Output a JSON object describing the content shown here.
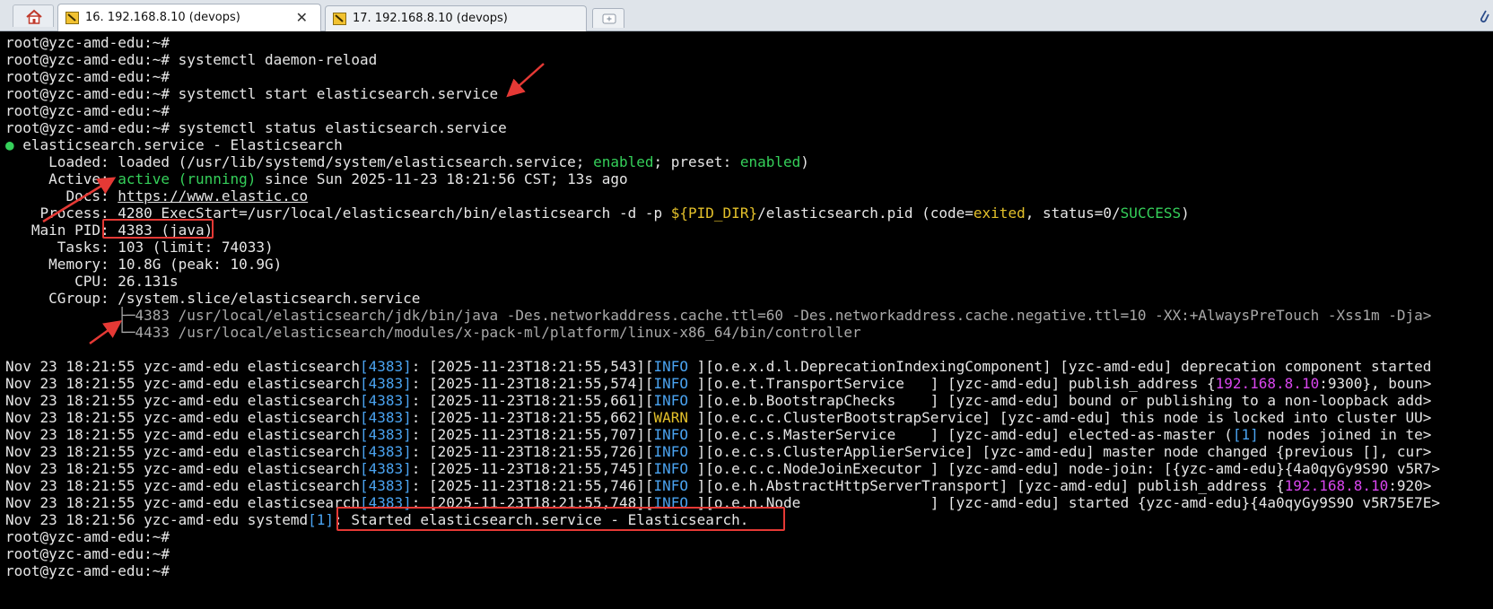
{
  "tabs": [
    {
      "label": "16. 192.168.8.10 (devops)",
      "close": "✕"
    },
    {
      "label": "17. 192.168.8.10 (devops)"
    }
  ],
  "terminal": {
    "prompt": "root@yzc-amd-edu:~#",
    "cmds": {
      "daemon_reload": "systemctl daemon-reload",
      "start": "systemctl start elasticsearch.service",
      "status": "systemctl status elasticsearch.service"
    },
    "status": {
      "bullet": "●",
      "unit_title": "elasticsearch.service - Elasticsearch",
      "loaded_label": "Loaded:",
      "loaded_pre": "loaded (/usr/lib/systemd/system/elasticsearch.service;",
      "loaded_enabled": "enabled",
      "loaded_mid": "; preset:",
      "loaded_preset": "enabled",
      "loaded_end": ")",
      "active_label": "Active:",
      "active_state": "active (running)",
      "active_since": "since Sun 2025-11-23 18:21:56 CST; 13s ago",
      "docs_label": "Docs:",
      "docs_url": "https://www.elastic.co",
      "process_label": "Process:",
      "process_pre": "4280 ExecStart=/usr/local/elasticsearch/bin/elasticsearch -d -p",
      "process_var": "${PID_DIR}",
      "process_mid": "/elasticsearch.pid (code=",
      "process_exited": "exited",
      "process_mid2": ", status=0/",
      "process_success": "SUCCESS",
      "process_end": ")",
      "mainpid_label": "Main PID:",
      "mainpid_value": "4383 (java)",
      "tasks_label": "Tasks:",
      "tasks_value": "103 (limit: 74033)",
      "memory_label": "Memory:",
      "memory_value": "10.8G (peak: 10.9G)",
      "cpu_label": "CPU:",
      "cpu_value": "26.131s",
      "cgroup_label": "CGroup:",
      "cgroup_value": "/system.slice/elasticsearch.service",
      "tree1_pid": "4383",
      "tree1_cmd": "/usr/local/elasticsearch/jdk/bin/java -Des.networkaddress.cache.ttl=60 -Des.networkaddress.cache.negative.ttl=10 -XX:+AlwaysPreTouch -Xss1m -Dja>",
      "tree2_pid": "4433",
      "tree2_cmd": "/usr/local/elasticsearch/modules/x-pack-ml/platform/linux-x86_64/bin/controller"
    },
    "logs": [
      {
        "prefix": "Nov 23 18:21:55 yzc-amd-edu elasticsearch",
        "pid": "[4383]",
        "ts": ": [2025-11-23T18:21:55,543][",
        "level": "INFO ",
        "rest": "][o.e.x.d.l.DeprecationIndexingComponent] [yzc-amd-edu] deprecation component started"
      },
      {
        "prefix": "Nov 23 18:21:55 yzc-amd-edu elasticsearch",
        "pid": "[4383]",
        "ts": ": [2025-11-23T18:21:55,574][",
        "level": "INFO ",
        "rest": "][o.e.t.TransportService   ] [yzc-amd-edu] publish_address {",
        "ip": "192.168.8.10",
        "tail": ":9300}, boun>"
      },
      {
        "prefix": "Nov 23 18:21:55 yzc-amd-edu elasticsearch",
        "pid": "[4383]",
        "ts": ": [2025-11-23T18:21:55,661][",
        "level": "INFO ",
        "rest": "][o.e.b.BootstrapChecks    ] [yzc-amd-edu] bound or publishing to a non-loopback add>"
      },
      {
        "prefix": "Nov 23 18:21:55 yzc-amd-edu elasticsearch",
        "pid": "[4383]",
        "ts": ": [2025-11-23T18:21:55,662][",
        "level": "WARN ",
        "rest": "][o.e.c.c.ClusterBootstrapService] [yzc-amd-edu] this node is locked into cluster UU>"
      },
      {
        "prefix": "Nov 23 18:21:55 yzc-amd-edu elasticsearch",
        "pid": "[4383]",
        "ts": ": [2025-11-23T18:21:55,707][",
        "level": "INFO ",
        "rest": "][o.e.c.s.MasterService    ] [yzc-amd-edu] elected-as-master (",
        "num": "[1]",
        "tail": " nodes joined in te>"
      },
      {
        "prefix": "Nov 23 18:21:55 yzc-amd-edu elasticsearch",
        "pid": "[4383]",
        "ts": ": [2025-11-23T18:21:55,726][",
        "level": "INFO ",
        "rest": "][o.e.c.s.ClusterApplierService] [yzc-amd-edu] master node changed {previous [], cur>"
      },
      {
        "prefix": "Nov 23 18:21:55 yzc-amd-edu elasticsearch",
        "pid": "[4383]",
        "ts": ": [2025-11-23T18:21:55,745][",
        "level": "INFO ",
        "rest": "][o.e.c.c.NodeJoinExecutor ] [yzc-amd-edu] node-join: [{yzc-amd-edu}{4a0qyGy9S9O v5R7>"
      },
      {
        "prefix": "Nov 23 18:21:55 yzc-amd-edu elasticsearch",
        "pid": "[4383]",
        "ts": ": [2025-11-23T18:21:55,746][",
        "level": "INFO ",
        "rest": "][o.e.h.AbstractHttpServerTransport] [yzc-amd-edu] publish_address {",
        "ip": "192.168.8.10",
        "tail": ":920>"
      },
      {
        "prefix": "Nov 23 18:21:55 yzc-amd-edu elasticsearch",
        "pid": "[4383]",
        "ts": ": [2025-11-23T18:21:55,748][",
        "level": "INFO ",
        "rest": "][o.e.n.Node               ] [yzc-amd-edu] started {yzc-amd-edu}{4a0qyGy9S9O v5R75E7E>"
      }
    ],
    "systemd_line": {
      "prefix": "Nov 23 18:21:56 yzc-amd-edu systemd",
      "pid": "[1]",
      "sep": ": ",
      "msg": "Started elasticsearch.service - Elasticsearch."
    }
  },
  "colors": {
    "accent_red": "#e53935",
    "term_green": "#35d05a",
    "term_blue": "#4aa3f0",
    "term_yellow": "#e3c02a",
    "term_magenta": "#d946ef"
  }
}
